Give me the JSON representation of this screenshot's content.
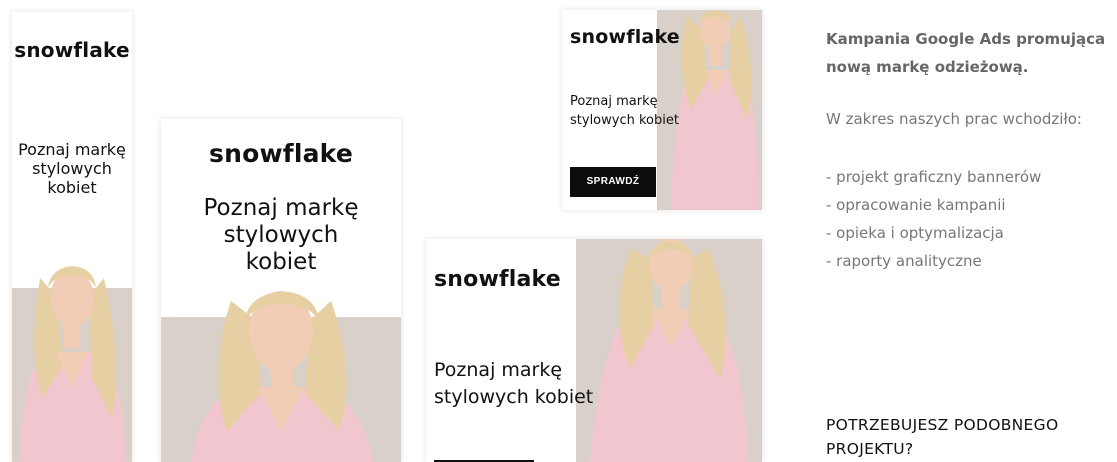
{
  "banners": {
    "skyscraper": {
      "brand": "snowflake",
      "headline_lines": [
        "Poznaj markę",
        "stylowych",
        "kobiet"
      ]
    },
    "square": {
      "brand": "snowflake",
      "headline_lines": [
        "Poznaj markę",
        "stylowych",
        "kobiet"
      ]
    },
    "small": {
      "brand": "snowflake",
      "headline_lines": [
        "Poznaj markę",
        "stylowych kobiet"
      ],
      "cta": "SPRAWDŹ"
    },
    "wide": {
      "brand": "snowflake",
      "headline_lines": [
        "Poznaj markę",
        "stylowych kobiet"
      ]
    }
  },
  "description": {
    "title_lines": [
      "Kampania Google Ads promująca",
      "nową markę odzieżową."
    ],
    "scope_intro": "W zakres naszych prac wchodziło:",
    "services": [
      "- projekt graficzny bannerów",
      "- opracowanie kampanii",
      "- opieka i optymalizacja",
      "- raporty analityczne"
    ],
    "cta_lines": [
      "POTRZEBUJESZ PODOBNEGO",
      "PROJEKTU?"
    ]
  },
  "colors": {
    "dress_pink": "#f2c6cf",
    "backdrop_beige": "#d9d1c9",
    "hair_blonde": "#e7cfa4",
    "skin": "#f1cdb5",
    "button": "#0d0d0d"
  }
}
